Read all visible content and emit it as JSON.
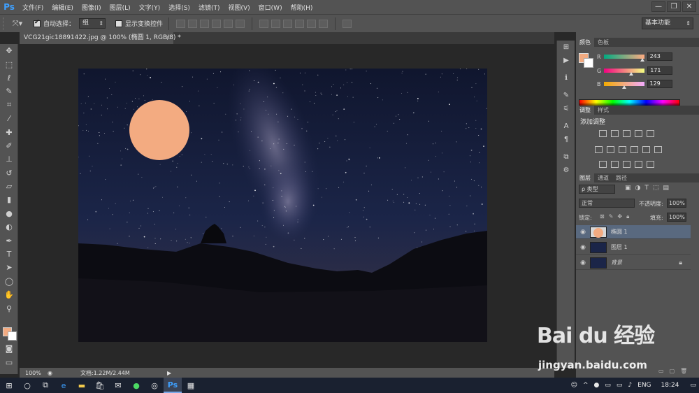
{
  "app": {
    "logo": "Ps",
    "menu": [
      "文件(F)",
      "编辑(E)",
      "图像(I)",
      "图层(L)",
      "文字(Y)",
      "选择(S)",
      "滤镜(T)",
      "视图(V)",
      "窗口(W)",
      "帮助(H)"
    ],
    "window_buttons": [
      "—",
      "❐",
      "✕"
    ]
  },
  "options_bar": {
    "auto_select_label": "自动选择：",
    "auto_select_value": "组",
    "show_transform_label": "显示变换控件",
    "workspace": "基本功能"
  },
  "document": {
    "tab_title": "VCG21gic18891422.jpg @ 100% (椭圆 1, RGB/8) *",
    "tab_close": "×"
  },
  "status": {
    "zoom": "100%",
    "doc_info": "文档:1.22M/2.44M"
  },
  "color_panel": {
    "tabs": [
      "颜色",
      "色板"
    ],
    "r_label": "R",
    "r": "243",
    "g_label": "G",
    "g": "171",
    "b_label": "B",
    "b": "129",
    "r_level": 0.95,
    "g_level": 0.67,
    "b_level": 0.51,
    "foreground": "#f3ab81",
    "background": "#ffffff"
  },
  "adjust_panel": {
    "tabs": [
      "调整",
      "样式"
    ],
    "heading": "添加调整"
  },
  "layers_panel": {
    "tabs": [
      "图层",
      "通道",
      "路径"
    ],
    "filter": "ρ 类型",
    "blend_mode": "正常",
    "opacity_label": "不透明度:",
    "opacity": "100%",
    "lock_label": "锁定:",
    "fill_label": "填充:",
    "fill": "100%",
    "layers": [
      {
        "name": "椭圆 1",
        "selected": true
      },
      {
        "name": "图层 1",
        "selected": false
      },
      {
        "name": "背景",
        "selected": false
      }
    ]
  },
  "taskbar": {
    "lang": "ENG",
    "time": "18:24"
  },
  "watermark": {
    "logo_text": "Bai du 经验",
    "url": "jingyan.baidu.com"
  }
}
